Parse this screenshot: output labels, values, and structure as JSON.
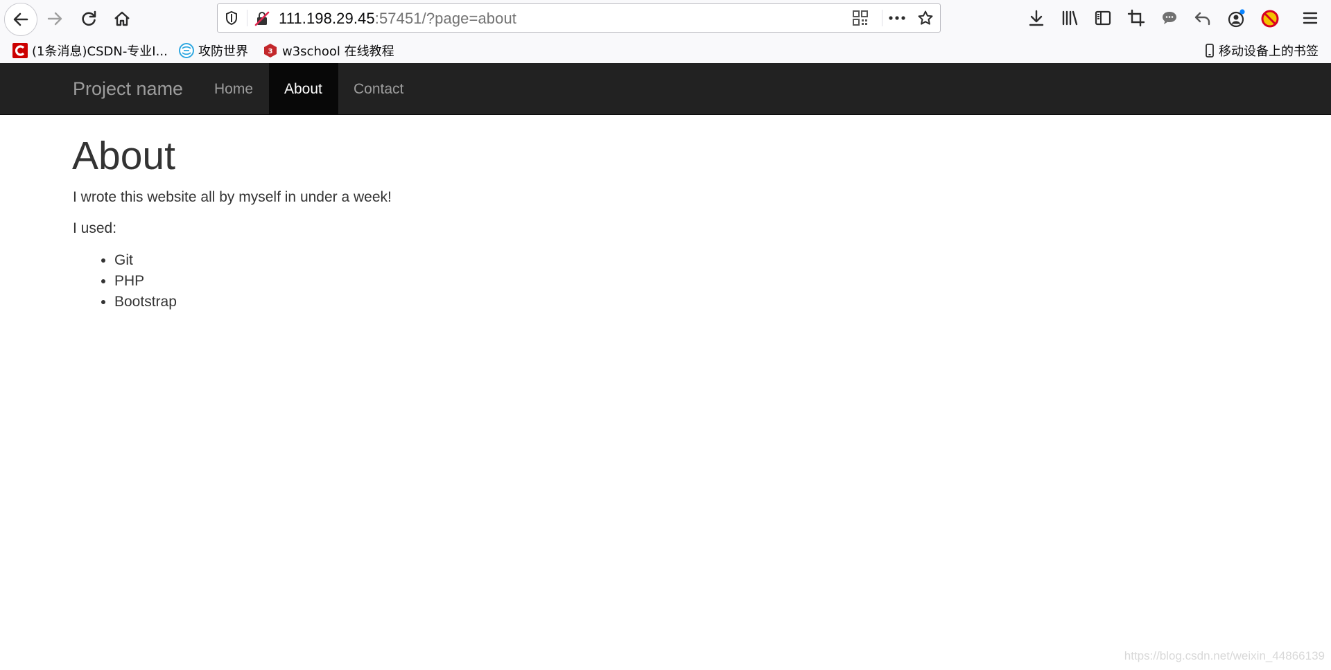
{
  "browser": {
    "url_host": "111.198.29.45",
    "url_rest": ":57451/?page=about",
    "bookmarks": [
      {
        "label": "(1条消息)CSDN-专业I...",
        "icon": "csdn-icon",
        "color": "#cc0000"
      },
      {
        "label": "攻防世界",
        "icon": "globe-icon",
        "color": "#2fa7e0"
      },
      {
        "label": "w3school 在线教程",
        "icon": "w3school-icon",
        "color": "#c3272b"
      }
    ],
    "mobile_bookmarks": "移动设备上的书签"
  },
  "navbar": {
    "brand": "Project name",
    "items": [
      {
        "label": "Home",
        "active": false
      },
      {
        "label": "About",
        "active": true
      },
      {
        "label": "Contact",
        "active": false
      }
    ],
    "bg_color": "#222222"
  },
  "content": {
    "title": "About",
    "intro": "I wrote this website all by myself in under a week!",
    "used_label": "I used:",
    "tools": [
      "Git",
      "PHP",
      "Bootstrap"
    ]
  },
  "watermark": "https://blog.csdn.net/weixin_44866139"
}
